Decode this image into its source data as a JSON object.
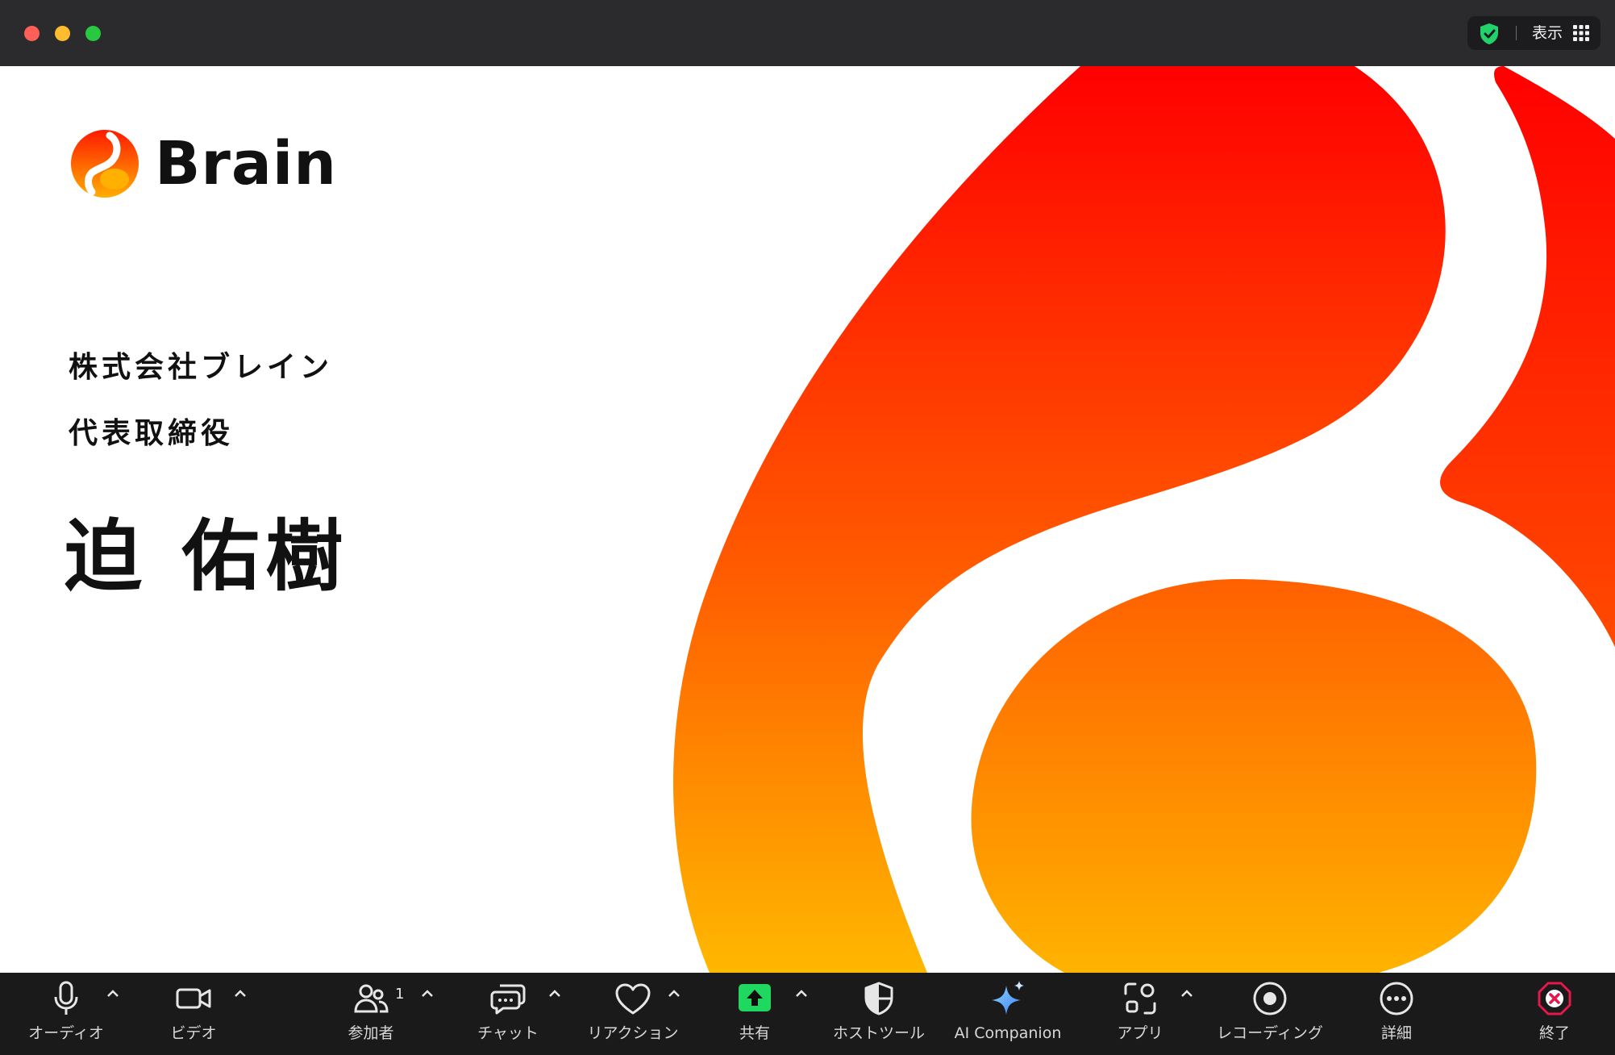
{
  "titlebar": {
    "view_label": "表示"
  },
  "slide": {
    "brand_name": "Brain",
    "company": "株式会社ブレイン",
    "role": "代表取締役",
    "person": "迫 佑樹"
  },
  "toolbar": {
    "audio": "オーディオ",
    "video": "ビデオ",
    "participants": "参加者",
    "participants_count": "1",
    "chat": "チャット",
    "reactions": "リアクション",
    "share": "共有",
    "host_tools": "ホストツール",
    "ai_companion": "AI Companion",
    "apps": "アプリ",
    "recording": "レコーディング",
    "more": "詳細",
    "end": "終了"
  },
  "colors": {
    "gradient_top": "#ff0000",
    "gradient_bottom": "#ffb800",
    "share_green": "#1fd860",
    "end_red": "#e5174b"
  }
}
